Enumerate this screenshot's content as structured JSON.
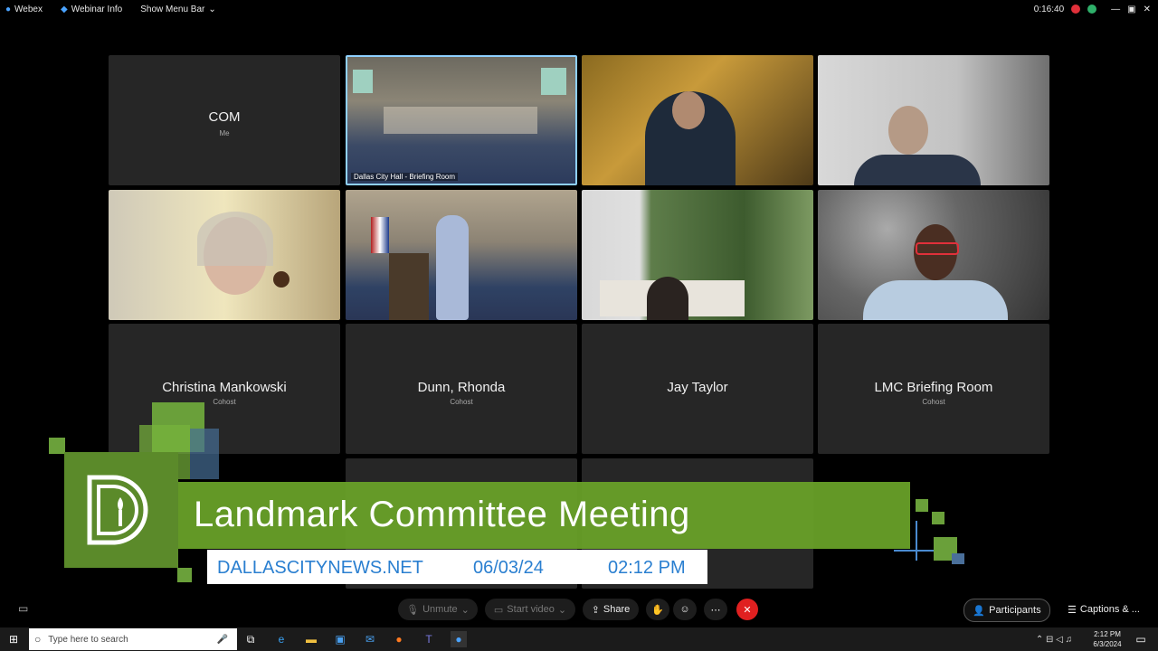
{
  "topbar": {
    "app_label": "Webex",
    "webinar_info_label": "Webinar Info",
    "show_menu_label": "Show Menu Bar",
    "timer": "0:16:40"
  },
  "tiles": [
    {
      "name": "COM",
      "role": "Me"
    },
    {
      "tag": "Dallas City Hall - Briefing Room"
    },
    {
      "name": "Christina Mankowski",
      "role": "Cohost"
    },
    {
      "name": "Dunn, Rhonda",
      "role": "Cohost"
    },
    {
      "name": "Jay Taylor",
      "role": ""
    },
    {
      "name": "LMC Briefing Room",
      "role": "Cohost"
    }
  ],
  "banner": {
    "title": "Landmark Committee Meeting",
    "site": "DALLASCITYNEWS.NET",
    "date": "06/03/24",
    "time": "02:12 PM"
  },
  "controls": {
    "unmute": "Unmute",
    "start_video": "Start video",
    "share": "Share",
    "participants": "Participants",
    "captions": "Captions & ..."
  },
  "taskbar": {
    "search_placeholder": "Type here to search",
    "clock_time": "2:12 PM",
    "clock_date": "6/3/2024"
  },
  "colors": {
    "banner_green": "#68a028",
    "logo_green": "#5b8a2a",
    "accent_blue": "#2a7fd0",
    "leave_red": "#e02020"
  }
}
